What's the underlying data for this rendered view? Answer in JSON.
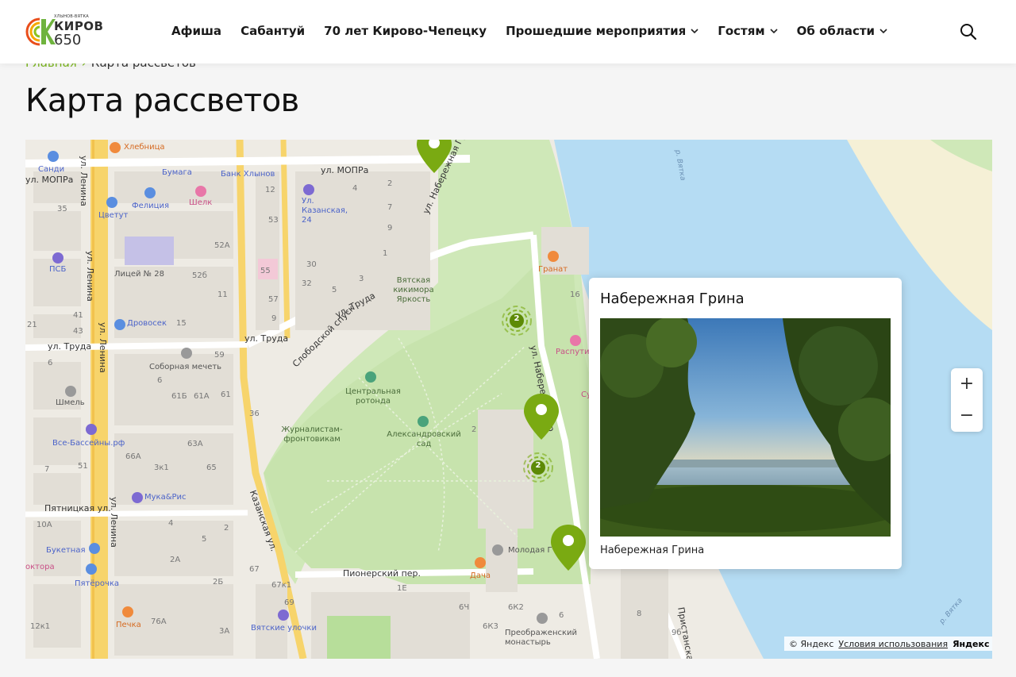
{
  "header": {
    "logo": {
      "subtitle": "ХЛЫНОВ-ВЯТКА",
      "word": "КИРОВ",
      "number": "650"
    },
    "nav": [
      {
        "label": "Афиша",
        "dropdown": false
      },
      {
        "label": "Сабантуй",
        "dropdown": false
      },
      {
        "label": "70 лет Кирово-Чепецку",
        "dropdown": false
      },
      {
        "label": "Прошедшие мероприятия",
        "dropdown": true
      },
      {
        "label": "Гостям",
        "dropdown": true
      },
      {
        "label": "Об области",
        "dropdown": true
      }
    ],
    "search_icon": "search-icon"
  },
  "breadcrumb": {
    "home": "Главная",
    "current": "Карта рассветов"
  },
  "page": {
    "title": "Карта рассветов"
  },
  "map": {
    "streets": {
      "mopra_top": "ул. МОПРа",
      "mopra_left": "ул. МОПРа",
      "lenina_1": "ул. Ленина",
      "lenina_2": "ул. Ленина",
      "lenina_3": "ул. Ленина",
      "lenina_4": "ул. Ленина",
      "truda_1": "ул. Труда",
      "truda_2": "ул. Труда",
      "truda_3": "ул. Труда",
      "naberezhnaya_1": "ул. Набережная Грина",
      "naberezhnaya_2": "ул. Набережная Гр",
      "slobodskoy": "Слободской спуск",
      "kazanskaya": "Казанская ул.",
      "pyatnitskaya": "Пятницкая ул.",
      "pionersky": "Пионерский пер.",
      "pristanskaya": "Пристанская",
      "river_1": "р. Вятка",
      "river_2": "р. Вятка"
    },
    "pois": {
      "khlebnitsa": "Хлебница",
      "sandi": "Санди",
      "bumaga": "Бумага",
      "bank": "Банк Хлынов",
      "felitsia": "Фелиция",
      "shelk": "Шелк",
      "kazanskaya24": "Ул. Казанская, 24",
      "tsvetut": "Цветут",
      "psb": "ПСБ",
      "litsey": "Лицей № 28",
      "drovosek": "Дровосек",
      "sobornaya": "Соборная мечеть",
      "shmel": "Шмель",
      "basseiny": "Все-Бассейны.рф",
      "muka": "Мука&Рис",
      "buketnaya": "Букетная",
      "pyaterochka": "Пятёрочка",
      "doktora": "октора",
      "pechka": "Печка",
      "vyatskie": "Вятские улочки",
      "granat": "Гранат",
      "rasputin": "Распути",
      "su": "Су",
      "kikimora": "Вятская кикимора Яркость",
      "rotonda": "Центральная ротонда",
      "zhurnalistam": "Журналистам-фронтовикам",
      "sad": "Александровский сад",
      "dacha": "Дача",
      "molodaya": "Молодая Г",
      "preobrazhensky": "Преображенский монастырь"
    },
    "house_numbers": {
      "n35": "35",
      "n12a": "12",
      "n53": "53",
      "n52a": "52А",
      "n2a": "2",
      "n7a": "7",
      "n9a": "9",
      "n4a": "4",
      "n30": "30",
      "n32": "32",
      "n5a": "5",
      "n3a": "3",
      "n55": "55",
      "n57": "57",
      "n9b": "9",
      "n52b": "52б",
      "n11": "11",
      "n15": "15",
      "n41": "41",
      "n43": "43",
      "n21": "21",
      "n59": "59",
      "n61": "61",
      "n61a": "61А",
      "n61b": "61Б",
      "n6a": "6",
      "n36": "36",
      "n63a": "63А",
      "n66a": "66А",
      "n3k1": "3к1",
      "n65": "65",
      "n51": "51",
      "n7b": "7",
      "n10a": "10А",
      "n4b": "4",
      "n2b": "2",
      "n5b": "5",
      "n2a_b": "2А",
      "n2b_b": "2Б",
      "n67": "67",
      "n67k1": "67к1",
      "n69": "69",
      "n76a": "76А",
      "n3a_b": "3А",
      "n12k1": "12к1",
      "n6b": "6",
      "n1e": "1Е",
      "n6ch": "6Ч",
      "n6k2": "6К2",
      "n6k3": "6К3",
      "n8": "8",
      "n16": "16",
      "n9_6": "9б",
      "n1a": "1",
      "n2c": "2",
      "n6c": "6"
    },
    "clusters": [
      {
        "count": "2"
      },
      {
        "count": "2"
      }
    ],
    "popup": {
      "title": "Набережная Грина",
      "caption": "Набережная Грина"
    },
    "zoom": {
      "in": "+",
      "out": "−"
    },
    "copyright": {
      "yandex": "© Яндекс",
      "terms": "Условия использования",
      "brand": "Яндекс"
    }
  },
  "colors": {
    "accent": "#7ab41d",
    "pin": "#7aaa12",
    "park": "#cfe8b8",
    "water": "#b5dcf3",
    "sand": "#f4efd6"
  }
}
